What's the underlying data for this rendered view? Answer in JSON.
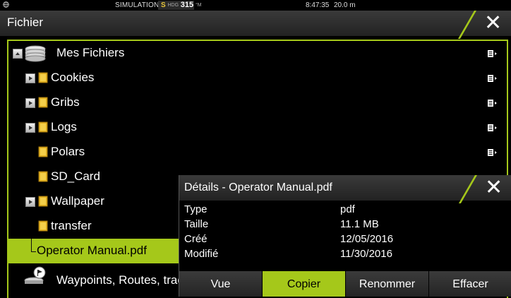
{
  "statusbar": {
    "simulation": "SIMULATION...",
    "hdg_letter": "S",
    "hdg_label": "HDG",
    "hdg_value": "315",
    "hdg_unit": "°M",
    "time": "8:47:35",
    "range": "20.0 m"
  },
  "window": {
    "title": "Fichier"
  },
  "files": {
    "root_label": "Mes Fichiers",
    "items": [
      {
        "label": "Cookies",
        "expandable": true
      },
      {
        "label": "Gribs",
        "expandable": true
      },
      {
        "label": "Logs",
        "expandable": true
      },
      {
        "label": "Polars",
        "expandable": false
      },
      {
        "label": "SD_Card",
        "expandable": false
      },
      {
        "label": "Wallpaper",
        "expandable": true
      },
      {
        "label": "transfer",
        "expandable": false
      }
    ],
    "selected_file": "Operator Manual.pdf",
    "waypoints_label": "Waypoints, Routes, traces"
  },
  "details_dialog": {
    "title": "Détails - Operator Manual.pdf",
    "rows": [
      {
        "key": "Type",
        "value": "pdf"
      },
      {
        "key": "Taille",
        "value": "11.1 MB"
      },
      {
        "key": "Créé",
        "value": "12/05/2016"
      },
      {
        "key": "Modifié",
        "value": "11/30/2016"
      }
    ],
    "actions": [
      {
        "label": "Vue",
        "active": false
      },
      {
        "label": "Copier",
        "active": true
      },
      {
        "label": "Renommer",
        "active": false
      },
      {
        "label": "Effacer",
        "active": false
      }
    ]
  },
  "colors": {
    "accent": "#a5c81a",
    "folder": "#e6b422",
    "background": "#000000"
  }
}
